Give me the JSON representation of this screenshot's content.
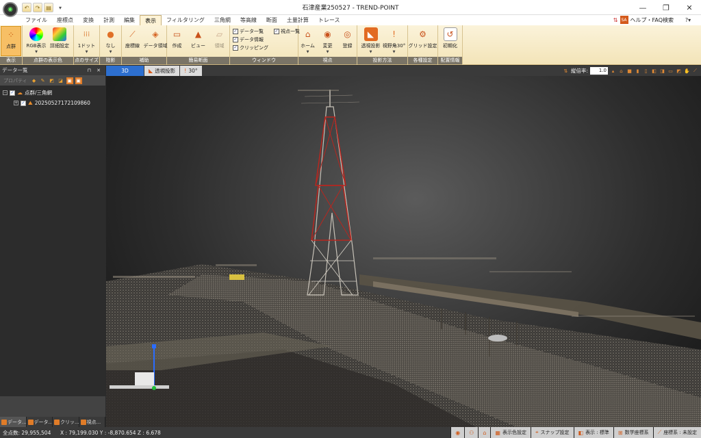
{
  "window": {
    "title": "石津産業250527 - TREND-POINT",
    "minimize_glyph": "—",
    "maximize_glyph": "❐",
    "close_glyph": "✕"
  },
  "qat": {
    "more": "▾"
  },
  "menu": {
    "tabs": [
      "ファイル",
      "座標点",
      "変換",
      "計測",
      "編集",
      "表示",
      "フィルタリング",
      "三角網",
      "等高線",
      "断面",
      "土量計算",
      "トレース"
    ],
    "active_tab": "表示",
    "help_label": "ヘルプ・FAQ検索",
    "help_icon": "SA",
    "help_btn_label": "?▾"
  },
  "ribbon": {
    "groups": {
      "display": {
        "label": "表示",
        "buttons": [
          {
            "label": "点群",
            "icon": "point-cloud-icon",
            "active": true
          }
        ]
      },
      "color": {
        "label": "点群の表示色",
        "buttons": [
          {
            "label": "RGB表示",
            "icon": "rgb-icon",
            "arrow": "▼"
          },
          {
            "label": "詳細設定",
            "icon": "color-settings-icon"
          }
        ]
      },
      "size": {
        "label": "点のサイズ",
        "buttons": [
          {
            "label": "1ドット",
            "icon": "dot-size-icon",
            "arrow": "▼"
          }
        ]
      },
      "shade": {
        "label": "陰影",
        "buttons": [
          {
            "label": "なし",
            "icon": "shade-icon",
            "arrow": "▼"
          }
        ]
      },
      "assist": {
        "label": "補助",
        "buttons": [
          {
            "label": "座標線",
            "icon": "axis-line-icon"
          },
          {
            "label": "データ領域",
            "icon": "data-area-icon"
          }
        ]
      },
      "section": {
        "label": "簡易断面",
        "buttons": [
          {
            "label": "作成",
            "icon": "create-section-icon"
          },
          {
            "label": "ビュー",
            "icon": "section-view-icon"
          },
          {
            "label": "領域",
            "icon": "section-area-icon",
            "disabled": true
          }
        ]
      },
      "window": {
        "label": "ウィンドウ",
        "checks": [
          {
            "label": "データ一覧",
            "checked": true
          },
          {
            "label": "データ情報",
            "checked": true
          },
          {
            "label": "クリッピング",
            "checked": true
          },
          {
            "label": "視点一覧",
            "checked": true
          }
        ]
      },
      "viewpoint": {
        "label": "視点",
        "buttons": [
          {
            "label": "ホーム",
            "icon": "home-icon",
            "arrow": "▼"
          },
          {
            "label": "変更",
            "icon": "change-view-icon",
            "arrow": "▼"
          },
          {
            "label": "登録",
            "icon": "register-view-icon"
          }
        ]
      },
      "projection": {
        "label": "投影方法",
        "buttons": [
          {
            "label": "透視投影",
            "icon": "perspective-icon",
            "arrow": "▼"
          },
          {
            "label": "視野角30°",
            "icon": "fov-icon",
            "arrow": "▼"
          }
        ]
      },
      "settings": {
        "label": "各種設定",
        "buttons": [
          {
            "label": "グリッド設定",
            "icon": "grid-settings-icon"
          }
        ]
      },
      "layout": {
        "label": "配置情報",
        "buttons": [
          {
            "label": "初期化",
            "icon": "reset-icon"
          }
        ]
      }
    }
  },
  "panel": {
    "title": "データ一覧",
    "pin": "⊓ ✕",
    "property_label": "プロパティ",
    "tree": [
      {
        "label": "点群/三角網",
        "expander": "−",
        "checked": true,
        "level": 0
      },
      {
        "label": "20250527172109860",
        "expander": "+",
        "checked": true,
        "level": 1
      }
    ],
    "tabs": [
      "データ...",
      "データ...",
      "クリッ...",
      "視点..."
    ]
  },
  "viewtabs": {
    "tabs": [
      "3D",
      "透視投影",
      "30°"
    ],
    "zoom_label": "縦倍率:",
    "zoom_value": "1.0"
  },
  "status": {
    "points": "全点数: 29,955,504",
    "coords": "X : 79,199.030  Y : -8,870.654  Z : 6.678",
    "buttons": [
      "表示色設定",
      "スナップ設定",
      "表示 : 標準",
      "数学座標系",
      "座標系 : 未設定"
    ]
  },
  "colors": {
    "accent_blue": "#2d6fcf",
    "ribbon": "#f3e4b8",
    "tower_red": "#b8261f"
  }
}
